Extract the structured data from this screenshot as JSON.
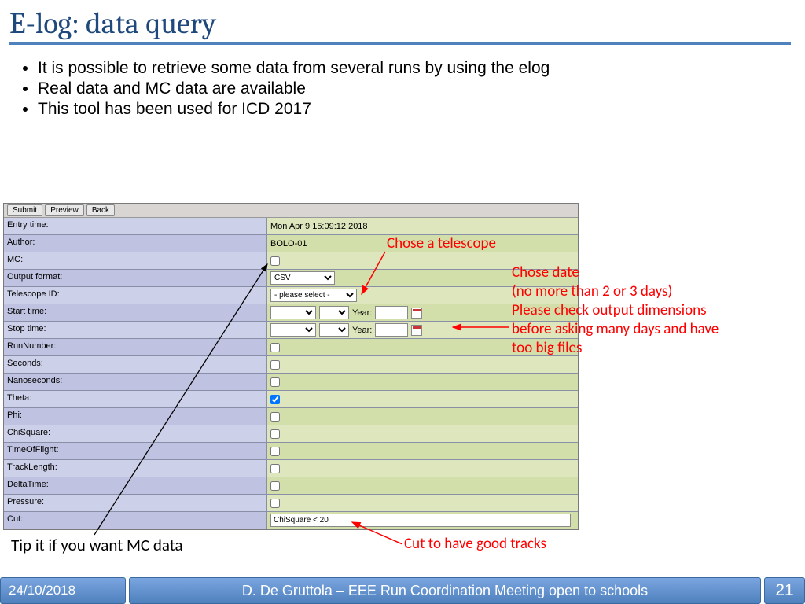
{
  "title": "E-log: data query",
  "bullets": [
    "It is possible to retrieve some data from several runs by using the elog",
    "Real data and MC data are available",
    "This tool has been used for ICD 2017"
  ],
  "buttons": {
    "submit": "Submit",
    "preview": "Preview",
    "back": "Back"
  },
  "rows": {
    "entry_time": {
      "label": "Entry time:",
      "value": "Mon Apr 9 15:09:12 2018"
    },
    "author": {
      "label": "Author:",
      "value": "BOLO-01"
    },
    "mc": {
      "label": "MC:"
    },
    "output": {
      "label": "Output format:",
      "value": "CSV"
    },
    "telescope": {
      "label": "Telescope ID:",
      "value": "- please select -"
    },
    "start": {
      "label": "Start time:",
      "year": "Year:"
    },
    "stop": {
      "label": "Stop time:",
      "year": "Year:"
    },
    "runnum": {
      "label": "RunNumber:"
    },
    "seconds": {
      "label": "Seconds:"
    },
    "nano": {
      "label": "Nanoseconds:"
    },
    "theta": {
      "label": "Theta:"
    },
    "phi": {
      "label": "Phi:"
    },
    "chi": {
      "label": "ChiSquare:"
    },
    "tof": {
      "label": "TimeOfFlight:"
    },
    "tl": {
      "label": "TrackLength:"
    },
    "dt": {
      "label": "DeltaTime:"
    },
    "press": {
      "label": "Pressure:"
    },
    "cut": {
      "label": "Cut:",
      "value": "ChiSquare < 20"
    }
  },
  "annot": {
    "telescope": "Chose a telescope",
    "date1": "Chose date",
    "date2": "(no more than 2 or 3 days)",
    "date3": "Please check output dimensions",
    "date4": "before asking many days and have",
    "date5": "too big files",
    "mc": "Tip it if you want MC data",
    "cut": "Cut to have good tracks"
  },
  "footer": {
    "date": "24/10/2018",
    "author": "D. De Gruttola – EEE Run Coordination Meeting open to schools",
    "page": "21"
  }
}
